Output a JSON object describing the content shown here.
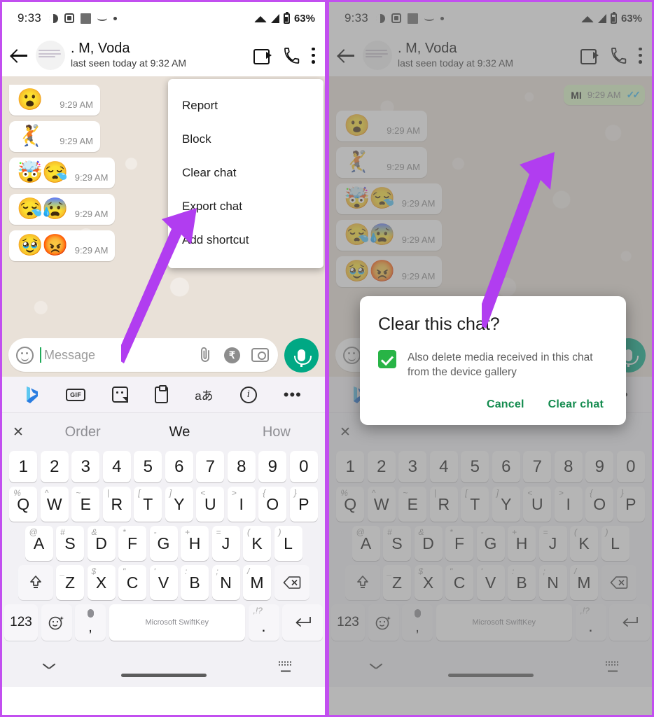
{
  "status_bar": {
    "time": "9:33",
    "battery": "63%",
    "icons": [
      "half-circle-icon",
      "scan-icon",
      "square-icon",
      "curve-icon",
      "dot-icon",
      "wifi-icon",
      "signal-icon",
      "battery-icon"
    ]
  },
  "chat_header": {
    "name": ". M, Voda",
    "subtitle": "last seen today at 9:32 AM",
    "back_icon": "back-arrow-icon",
    "video_icon": "video-call-icon",
    "call_icon": "voice-call-icon",
    "overflow_icon": "more-vert-icon"
  },
  "messages": {
    "outgoing": {
      "text": "MI",
      "time": "9:29 AM",
      "ticks": "✓✓"
    },
    "incoming": [
      {
        "emoji": "😮",
        "time": "9:29 AM"
      },
      {
        "emoji": "🤾",
        "time": "9:29 AM"
      },
      {
        "emoji": "🤯😪",
        "time": "9:29 AM"
      },
      {
        "emoji": "😪😰",
        "time": "9:29 AM"
      },
      {
        "emoji": "🥹😡",
        "time": "9:29 AM"
      }
    ]
  },
  "overflow_menu": {
    "items": [
      {
        "label": "Report"
      },
      {
        "label": "Block"
      },
      {
        "label": "Clear chat"
      },
      {
        "label": "Export chat"
      },
      {
        "label": "Add shortcut"
      }
    ]
  },
  "input_bar": {
    "placeholder": "Message",
    "value": "",
    "emoji_icon": "smiley-icon",
    "attach_icon": "paperclip-icon",
    "payment_icon": "rupee-payment-icon",
    "payment_glyph": "₹",
    "camera_icon": "camera-icon",
    "mic_icon": "microphone-icon"
  },
  "swiftkey_toolbar": {
    "items": [
      {
        "name": "bing-icon",
        "label": ""
      },
      {
        "name": "gif-icon",
        "label": "GIF"
      },
      {
        "name": "sticker-icon",
        "label": ""
      },
      {
        "name": "clipboard-icon",
        "label": ""
      },
      {
        "name": "translate-icon",
        "label": "aあ"
      },
      {
        "name": "info-icon",
        "label": "i"
      },
      {
        "name": "more-icon",
        "label": "•••"
      }
    ]
  },
  "keyboard": {
    "suggestions": [
      {
        "text": "Order",
        "active": false
      },
      {
        "text": "We",
        "active": true
      },
      {
        "text": "How",
        "active": false
      }
    ],
    "close_label": "✕",
    "number_row": [
      "1",
      "2",
      "3",
      "4",
      "5",
      "6",
      "7",
      "8",
      "9",
      "0"
    ],
    "row1": [
      {
        "key": "Q",
        "sup": "%"
      },
      {
        "key": "W",
        "sup": "^"
      },
      {
        "key": "E",
        "sup": "~"
      },
      {
        "key": "R",
        "sup": "|"
      },
      {
        "key": "T",
        "sup": "["
      },
      {
        "key": "Y",
        "sup": "]"
      },
      {
        "key": "U",
        "sup": "<"
      },
      {
        "key": "I",
        "sup": ">"
      },
      {
        "key": "O",
        "sup": "{"
      },
      {
        "key": "P",
        "sup": "}"
      }
    ],
    "row2": [
      {
        "key": "A",
        "sup": "@"
      },
      {
        "key": "S",
        "sup": "#"
      },
      {
        "key": "D",
        "sup": "&"
      },
      {
        "key": "F",
        "sup": "*"
      },
      {
        "key": "G",
        "sup": "-"
      },
      {
        "key": "H",
        "sup": "+"
      },
      {
        "key": "J",
        "sup": "="
      },
      {
        "key": "K",
        "sup": "("
      },
      {
        "key": "L",
        "sup": ")"
      }
    ],
    "row3": [
      {
        "key": "Z",
        "sup": "_"
      },
      {
        "key": "X",
        "sup": "$"
      },
      {
        "key": "C",
        "sup": "\""
      },
      {
        "key": "V",
        "sup": "'"
      },
      {
        "key": "B",
        "sup": ":"
      },
      {
        "key": "N",
        "sup": ";"
      },
      {
        "key": "M",
        "sup": "/"
      }
    ],
    "shift_icon": "shift-icon",
    "backspace_icon": "backspace-icon",
    "numeric_label": "123",
    "emoji_key_icon": "emoji-key-icon",
    "mic_key_icon": "mic-key-icon",
    "comma_label": ",",
    "space_label": "Microsoft SwiftKey",
    "period_label": ".",
    "period_sup": ",!?",
    "enter_icon": "enter-icon"
  },
  "nav_bar": {
    "hide_keyboard_icon": "chevron-down-icon",
    "home_pill": "home-pill",
    "switch_keyboard_icon": "keyboard-switch-icon"
  },
  "dialog": {
    "title": "Clear this chat?",
    "checkbox_checked": true,
    "checkbox_label": "Also delete media received in this chat from the device gallery",
    "cancel_label": "Cancel",
    "confirm_label": "Clear chat"
  },
  "annotations": {
    "arrow_color": "#b13df0",
    "left_arrow_target": "Clear chat / Export chat menu item",
    "right_arrow_target": "Clear chat dialog button"
  },
  "colors": {
    "frame_border": "#c24ff0",
    "whatsapp_green": "#00a884",
    "outgoing_bubble": "#dcf8c6",
    "chat_background": "#e9e1d8",
    "dialog_action": "#138b4e",
    "checkbox_green": "#28b446",
    "tick_blue": "#34b7f1"
  }
}
